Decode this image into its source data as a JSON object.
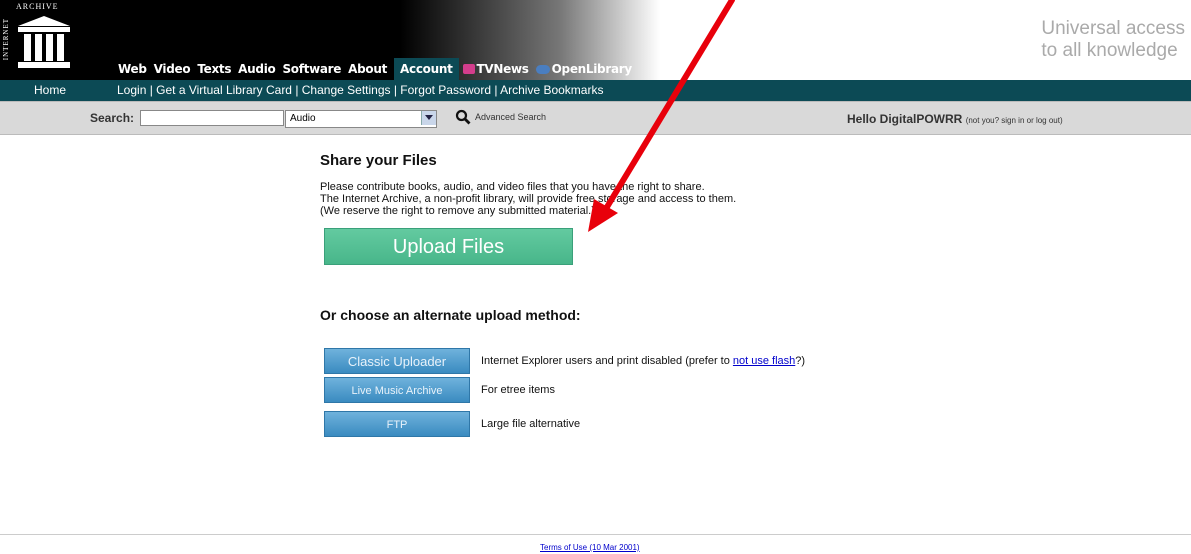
{
  "header": {
    "logo": {
      "side_text": "INTERNET",
      "top_text": "ARCHIVE"
    },
    "nav": [
      "Web",
      "Video",
      "Texts",
      "Audio",
      "Software",
      "About",
      "Account"
    ],
    "brands": [
      "TVNews",
      "OpenLibrary"
    ],
    "tagline_line1": "Universal access",
    "tagline_line2": "to all knowledge"
  },
  "subnav": {
    "home": "Home",
    "links": "Login | Get a Virtual Library Card | Change Settings | Forgot Password | Archive Bookmarks"
  },
  "search": {
    "label": "Search:",
    "input_value": "",
    "select_value": "Audio",
    "advanced": "Advanced Search",
    "hello": "Hello DigitalPOWRR",
    "hello_small": "(not you? sign in or log out)"
  },
  "main": {
    "title": "Share your Files",
    "desc_line1": "Please contribute books, audio, and video files that you have the right to share.",
    "desc_line2": "The Internet Archive, a non-profit library, will provide free storage and access to them.",
    "desc_line3": "(We reserve the right to remove any submitted material.)",
    "upload_button": "Upload Files",
    "alt_title": "Or choose an alternate upload method:",
    "alternates": [
      {
        "button": "Classic Uploader",
        "text": "Internet Explorer users and print disabled (prefer to ",
        "link": "not use flash",
        "suffix": "?)"
      },
      {
        "button": "Live Music Archive",
        "text": "For etree items"
      },
      {
        "button": "FTP",
        "text": "Large file alternative"
      }
    ]
  },
  "footer": {
    "terms": "Terms of Use (10 Mar 2001)"
  },
  "colors": {
    "teal_bar": "#0c4a55",
    "upload_green": "#4fbd90",
    "alt_blue": "#4a97c8",
    "arrow_red": "#e8000b"
  }
}
